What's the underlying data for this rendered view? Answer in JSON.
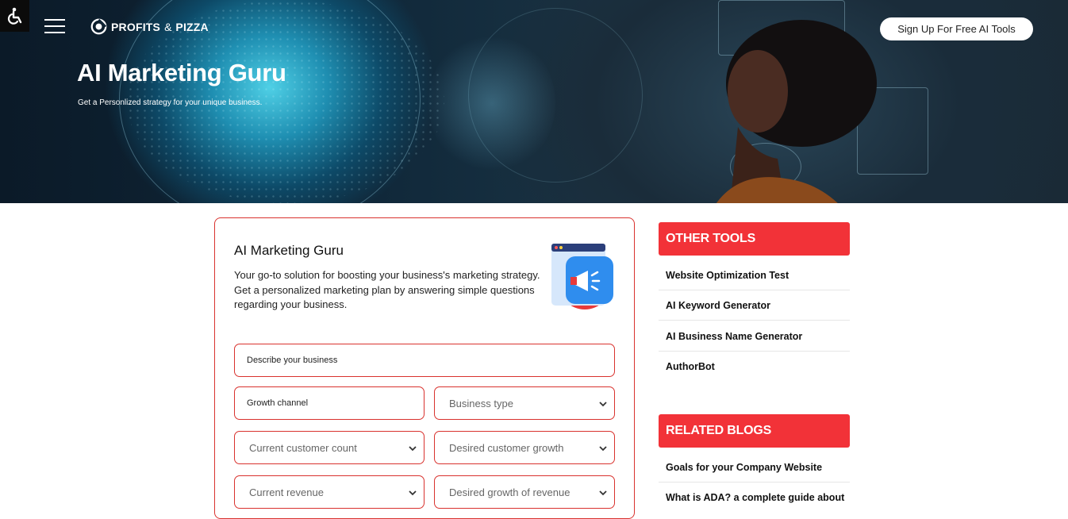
{
  "header": {
    "logo_text": "PROFITS",
    "logo_amp": "&",
    "logo_text2": "PIZZA",
    "signup_label": "Sign Up For Free AI Tools",
    "hero_title": "AI Marketing Guru",
    "hero_subtitle": "Get a Personlized strategy for your unique business."
  },
  "card": {
    "title": "AI Marketing Guru",
    "description": "Your go-to solution for boosting your business's marketing strategy. Get a personalized marketing plan by answering simple questions regarding your business.",
    "fields": {
      "describe": "Describe your business",
      "growth_channel": "Growth channel",
      "business_type": "Business type",
      "customer_count": "Current customer count",
      "customer_growth": "Desired customer growth",
      "revenue": "Current revenue",
      "revenue_growth": "Desired growth of revenue"
    }
  },
  "sidebar": {
    "tools_heading": "OTHER TOOLS",
    "tools": [
      "Website Optimization Test",
      "AI Keyword Generator",
      "AI Business Name Generator",
      "AuthorBot"
    ],
    "blogs_heading": "RELATED BLOGS",
    "blogs": [
      "Goals for your Company Website",
      "What is ADA? a complete guide about"
    ]
  },
  "colors": {
    "accent_red": "#f23238",
    "border_red": "#d9322e"
  },
  "icons": [
    "accessibility-icon",
    "hamburger-menu-icon",
    "logo-mark-icon",
    "megaphone-illustration-icon",
    "chevron-down-icon"
  ]
}
